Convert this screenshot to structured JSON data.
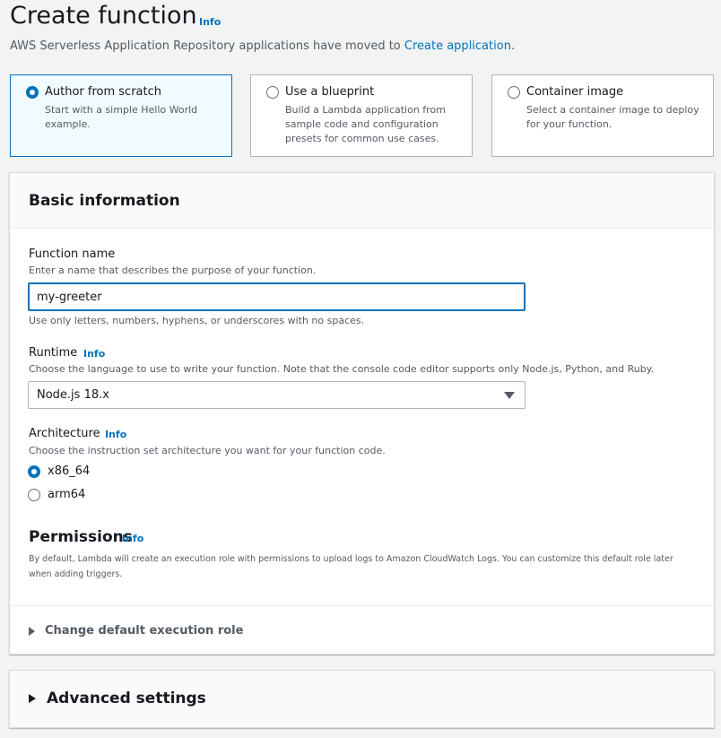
{
  "header": {
    "title": "Create function",
    "info_label": "Info",
    "subtitle_text": "AWS Serverless Application Repository applications have moved to ",
    "subtitle_link": "Create application",
    "subtitle_end": "."
  },
  "options": [
    {
      "title": "Author from scratch",
      "description": "Start with a simple Hello World example.",
      "selected": true
    },
    {
      "title": "Use a blueprint",
      "description": "Build a Lambda application from sample code and configuration presets for common use cases.",
      "selected": false
    },
    {
      "title": "Container image",
      "description": "Select a container image to deploy for your function.",
      "selected": false
    }
  ],
  "basic_info": {
    "title": "Basic information",
    "function_name": {
      "label": "Function name",
      "description": "Enter a name that describes the purpose of your function.",
      "value": "my-greeter",
      "constraint": "Use only letters, numbers, hyphens, or underscores with no spaces."
    },
    "runtime": {
      "label": "Runtime",
      "info_label": "Info",
      "description": "Choose the language to use to write your function. Note that the console code editor supports only Node.js, Python, and Ruby.",
      "value": "Node.js 18.x"
    },
    "architecture": {
      "label": "Architecture",
      "info_label": "Info",
      "description": "Choose the instruction set architecture you want for your function code.",
      "options": [
        "x86_64",
        "arm64"
      ],
      "selected": "x86_64"
    },
    "permissions": {
      "title": "Permissions",
      "info_label": "Info",
      "description": "By default, Lambda will create an execution role with permissions to upload logs to Amazon CloudWatch Logs. You can customize this default role later when adding triggers."
    },
    "execution_role_toggle": "Change default execution role"
  },
  "advanced_settings": {
    "label": "Advanced settings"
  },
  "colors": {
    "accent": "#0073bb",
    "background": "#f2f3f3",
    "selected_tile_bg": "#f1faff"
  }
}
